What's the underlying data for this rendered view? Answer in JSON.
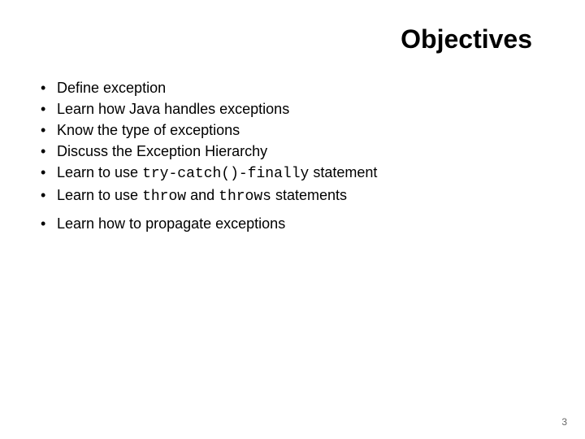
{
  "title": "Objectives",
  "bullets": [
    {
      "text": "Define exception"
    },
    {
      "text": "Learn how Java handles exceptions"
    },
    {
      "text": "Know the type of exceptions"
    },
    {
      "text": "Discuss the Exception Hierarchy"
    },
    {
      "prefix": "Learn to use ",
      "code": "try-catch()-finally",
      "suffix": " statement"
    },
    {
      "prefix": "Learn to use ",
      "code": "throw",
      "mid": " and ",
      "code2": "throws",
      "suffix": " statements"
    },
    {
      "text": "Learn how to propagate exceptions",
      "extraGap": true
    }
  ],
  "pageNumber": "3"
}
